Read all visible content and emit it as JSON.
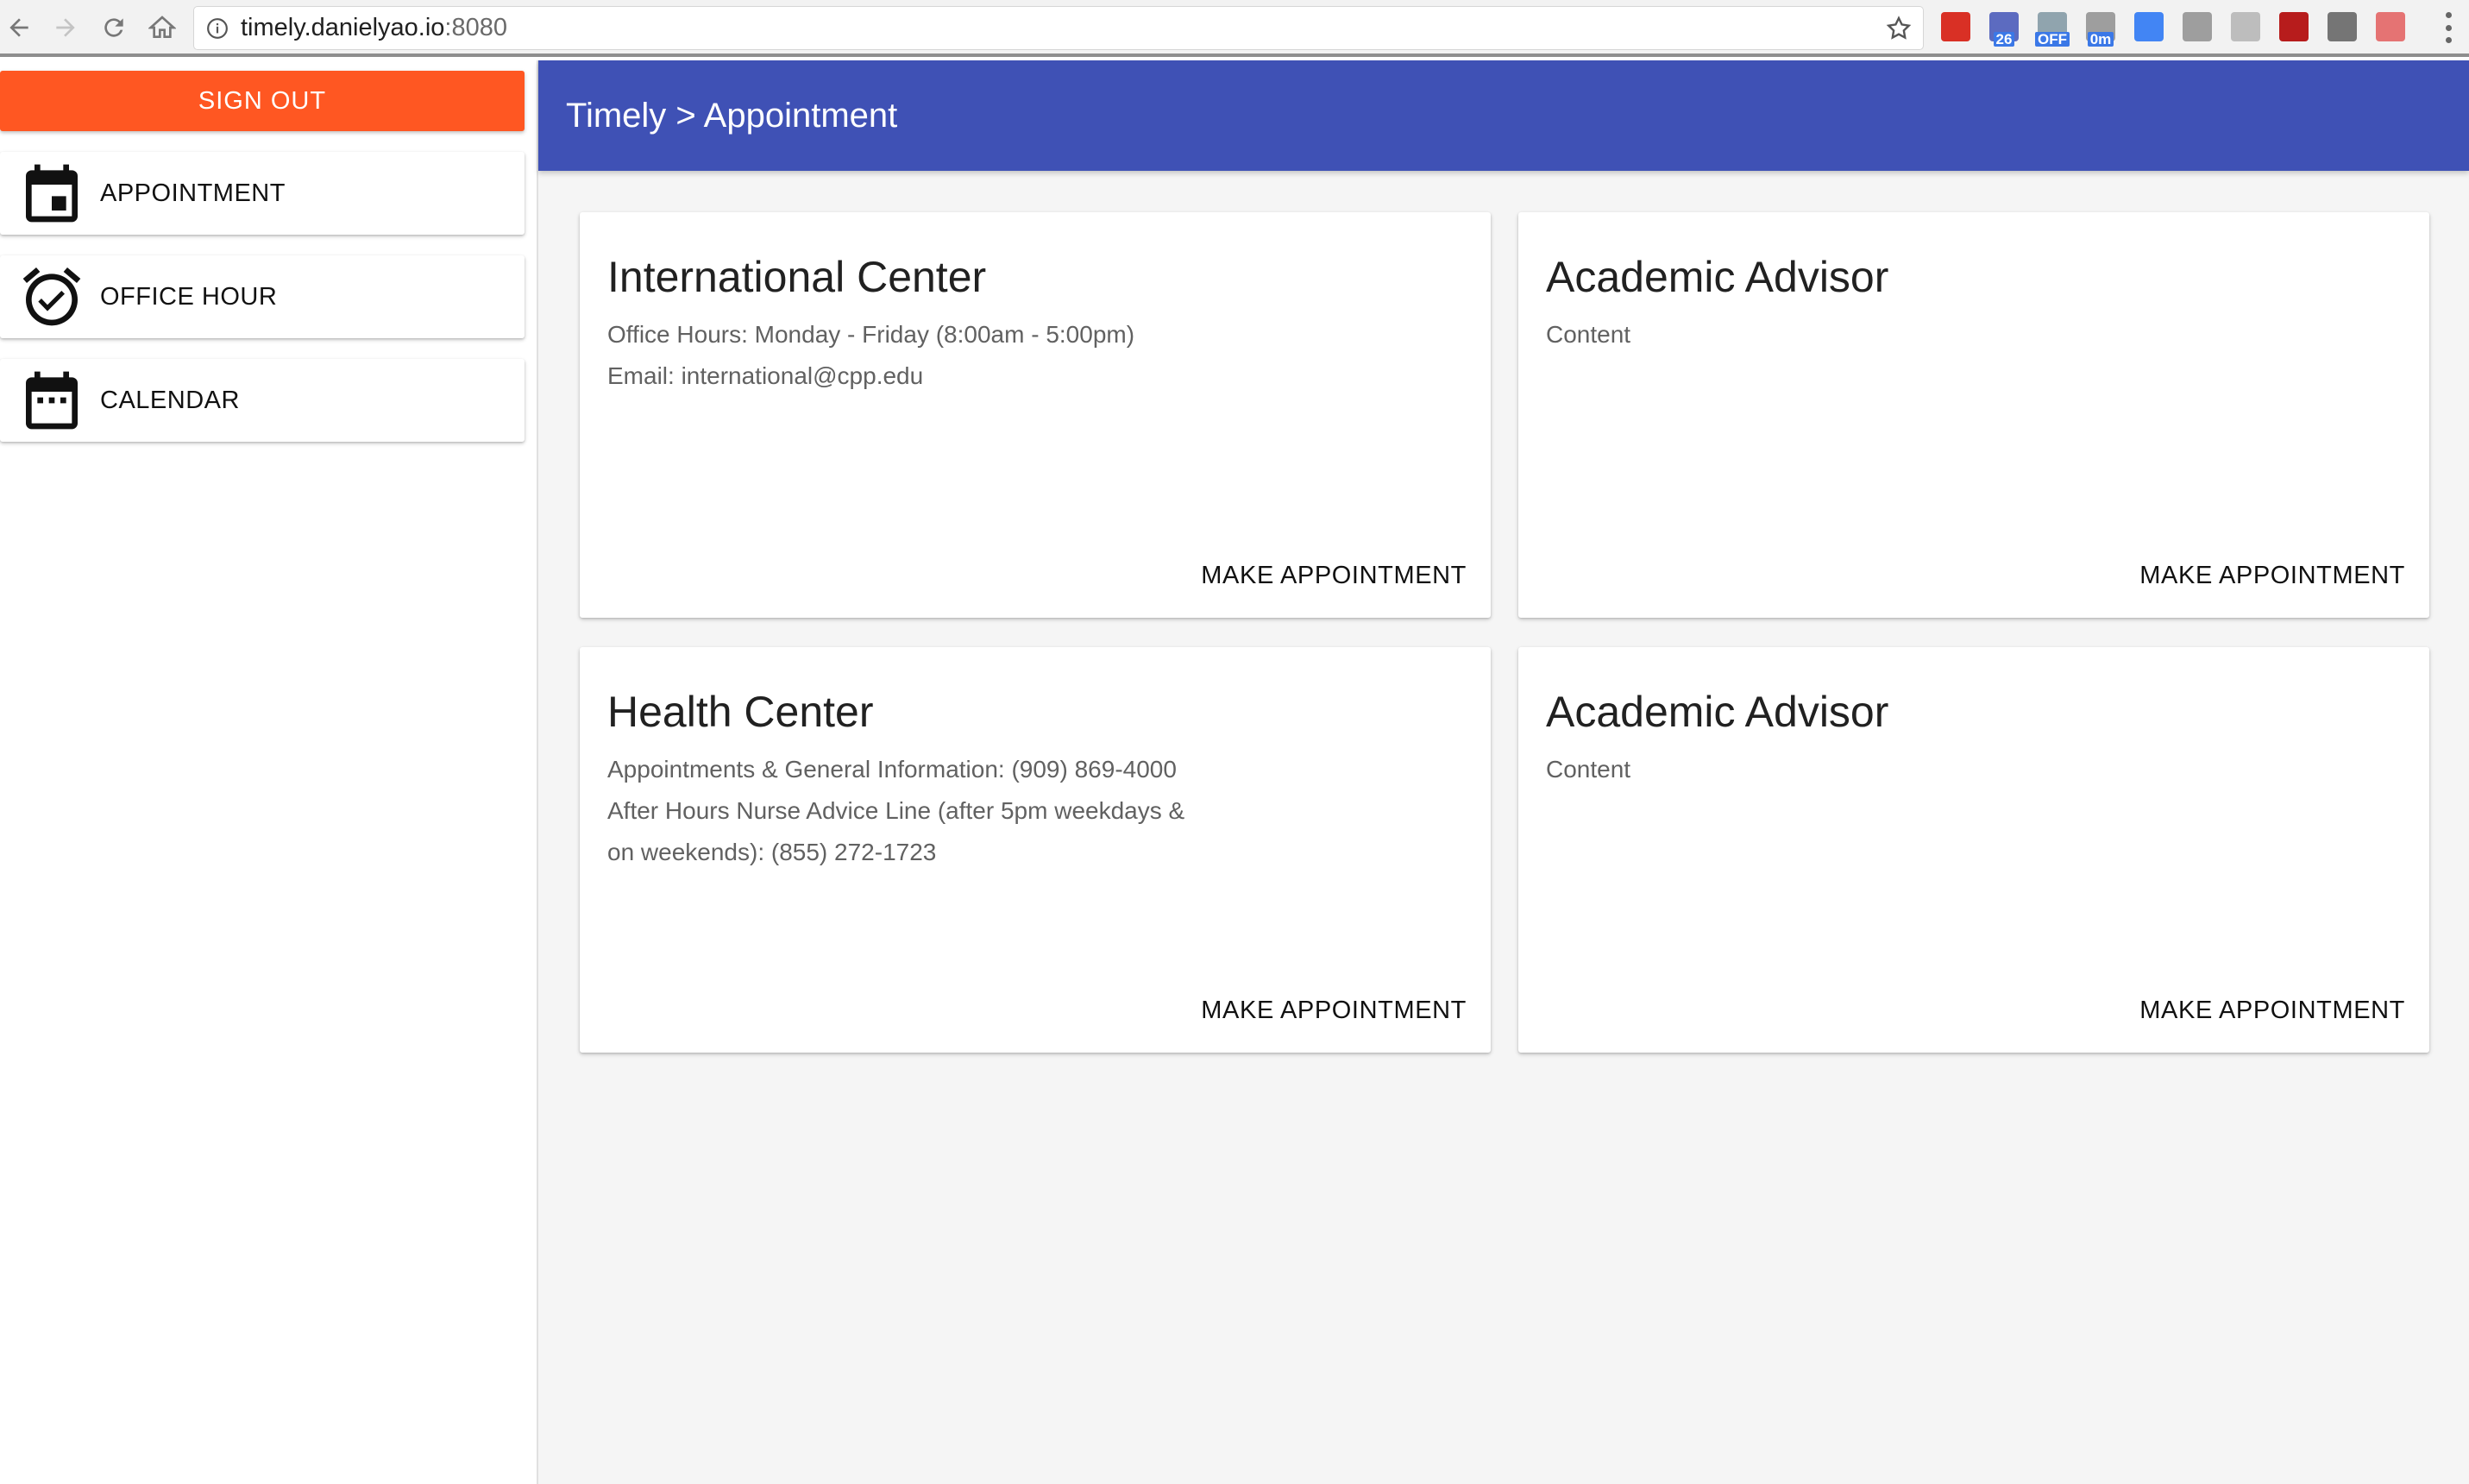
{
  "browser": {
    "url_host": "timely.danielyao.io",
    "url_port": ":8080",
    "extensions": [
      {
        "name": "gmail",
        "color": "#d93025",
        "badge": ""
      },
      {
        "name": "calendar",
        "color": "#5c6bc0",
        "badge": "26"
      },
      {
        "name": "weather",
        "color": "#90a4ae",
        "badge": "OFF"
      },
      {
        "name": "timer",
        "color": "#9e9e9e",
        "badge": "0m"
      },
      {
        "name": "download",
        "color": "#4285f4",
        "badge": ""
      },
      {
        "name": "circle",
        "color": "#9e9e9e",
        "badge": ""
      },
      {
        "name": "grey",
        "color": "#bdbdbd",
        "badge": ""
      },
      {
        "name": "ublock",
        "color": "#b71c1c",
        "badge": ""
      },
      {
        "name": "list",
        "color": "#757575",
        "badge": ""
      },
      {
        "name": "red",
        "color": "#e57373",
        "badge": ""
      }
    ]
  },
  "sidebar": {
    "sign_out_label": "SIGN OUT",
    "items": [
      {
        "label": "APPOINTMENT",
        "icon": "calendar-today-icon"
      },
      {
        "label": "OFFICE HOUR",
        "icon": "alarm-check-icon"
      },
      {
        "label": "CALENDAR",
        "icon": "calendar-month-icon"
      }
    ]
  },
  "appbar": {
    "title": "Timely > Appointment"
  },
  "cards": [
    {
      "title": "International Center",
      "lines": [
        "Office Hours: Monday - Friday (8:00am - 5:00pm)",
        "Email: international@cpp.edu"
      ],
      "action": "MAKE APPOINTMENT"
    },
    {
      "title": "Academic Advisor",
      "lines": [
        "Content"
      ],
      "action": "MAKE APPOINTMENT"
    },
    {
      "title": "Health Center",
      "lines": [
        "Appointments & General Information: (909) 869-4000",
        "After Hours Nurse Advice Line (after 5pm weekdays &",
        "on weekends): (855) 272-1723"
      ],
      "action": "MAKE APPOINTMENT"
    },
    {
      "title": "Academic Advisor",
      "lines": [
        "Content"
      ],
      "action": "MAKE APPOINTMENT"
    }
  ],
  "colors": {
    "primary": "#3f51b5",
    "accent": "#ff5722",
    "background": "#f5f5f5"
  }
}
